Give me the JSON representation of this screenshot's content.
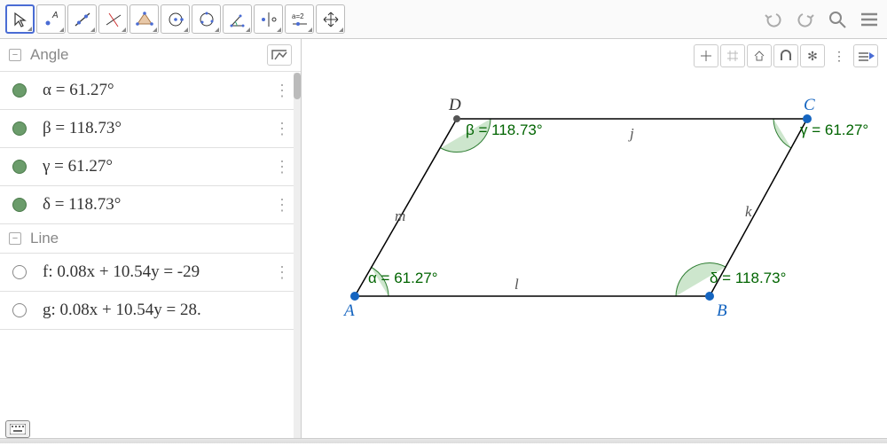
{
  "algebra": {
    "angle_header": "Angle",
    "line_header": "Line",
    "angles": [
      {
        "name": "α",
        "value": "61.27°"
      },
      {
        "name": "β",
        "value": "118.73°"
      },
      {
        "name": "γ",
        "value": "61.27°"
      },
      {
        "name": "δ",
        "value": "118.73°"
      }
    ],
    "lines": [
      {
        "name": "f",
        "eq": "0.08x + 10.54y = -29"
      },
      {
        "name": "g",
        "eq": "0.08x + 10.54y = 28."
      }
    ]
  },
  "graphics": {
    "points": {
      "A": "A",
      "B": "B",
      "C": "C",
      "D": "D"
    },
    "segments": {
      "j": "j",
      "k": "k",
      "l": "l",
      "m": "m"
    },
    "angle_labels": {
      "alpha": "α = 61.27°",
      "beta": "β = 118.73°",
      "gamma": "γ = 61.27°",
      "delta": "δ = 118.73°"
    }
  },
  "toolbar": {
    "tools": [
      "move",
      "point",
      "line",
      "perpendicular",
      "polygon",
      "circle",
      "ellipse",
      "angle",
      "reflect",
      "slider",
      "move-view"
    ]
  }
}
